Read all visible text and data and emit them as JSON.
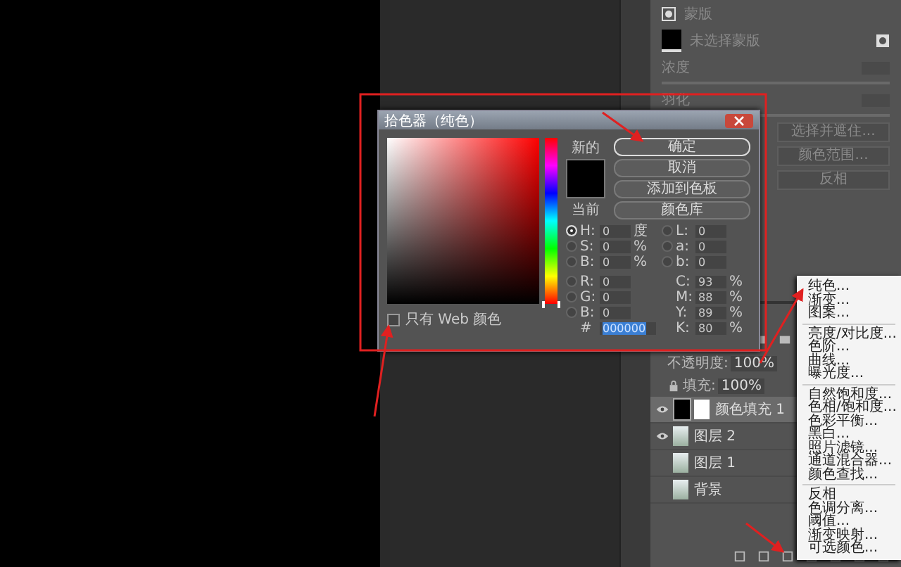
{
  "properties": {
    "mask_title": "蒙版",
    "mask_hint": "未选择蒙版",
    "sliders": [
      {
        "label": "浓度"
      },
      {
        "label": "羽化"
      }
    ],
    "buttons": [
      "选择并遮住...",
      "颜色范围...",
      "反相"
    ]
  },
  "dialog": {
    "title": "拾色器（纯色）",
    "new_label": "新的",
    "current_label": "当前",
    "buttons": [
      {
        "label": "确定",
        "default": true
      },
      {
        "label": "取消",
        "default": false
      },
      {
        "label": "添加到色板",
        "default": false
      },
      {
        "label": "颜色库",
        "default": false
      }
    ],
    "left_fields": [
      {
        "kind": "radio",
        "label": "H:",
        "value": "0",
        "unit": "度",
        "selected": true
      },
      {
        "kind": "radio",
        "label": "S:",
        "value": "0",
        "unit": "%",
        "selected": false
      },
      {
        "kind": "radio",
        "label": "B:",
        "value": "0",
        "unit": "%",
        "selected": false
      },
      {
        "kind": "radio",
        "label": "R:",
        "value": "0",
        "selected": false
      },
      {
        "kind": "radio",
        "label": "G:",
        "value": "0",
        "selected": false
      },
      {
        "kind": "radio",
        "label": "B:",
        "value": "0",
        "selected": false
      }
    ],
    "right_fields": [
      {
        "kind": "radio",
        "label": "L:",
        "value": "0",
        "selected": false
      },
      {
        "kind": "radio",
        "label": "a:",
        "value": "0",
        "selected": false
      },
      {
        "kind": "radio",
        "label": "b:",
        "value": "0",
        "selected": false
      },
      {
        "kind": "plain",
        "label": "C:",
        "value": "93",
        "unit": "%"
      },
      {
        "kind": "plain",
        "label": "M:",
        "value": "88",
        "unit": "%"
      },
      {
        "kind": "plain",
        "label": "Y:",
        "value": "89",
        "unit": "%"
      },
      {
        "kind": "plain",
        "label": "K:",
        "value": "80",
        "unit": "%"
      }
    ],
    "hue": {
      "level": 0
    },
    "hex": {
      "label": "#",
      "value": "000000"
    },
    "web_only": {
      "label": "只有 Web 颜色",
      "checked": false
    }
  },
  "layers": {
    "opacity_label": "不透明度:",
    "opacity": "100%",
    "fill_label": "填充:",
    "fill": "100%",
    "items": [
      {
        "name": "颜色填充 1",
        "kind": "fill",
        "visible": true,
        "selected": true
      },
      {
        "name": "图层 2",
        "kind": "image",
        "visible": true,
        "selected": false
      },
      {
        "name": "图层 1",
        "kind": "image",
        "visible": false,
        "selected": false
      },
      {
        "name": "背景",
        "kind": "image",
        "visible": false,
        "selected": false
      }
    ]
  },
  "menu": {
    "sections": [
      [
        "纯色...",
        "渐变...",
        "图案..."
      ],
      [
        "亮度/对比度...",
        "色阶...",
        "曲线...",
        "曝光度..."
      ],
      [
        "自然饱和度...",
        "色相/饱和度...",
        "色彩平衡...",
        "黑白...",
        "照片滤镜...",
        "通道混合器...",
        "颜色查找..."
      ],
      [
        "反相",
        "色调分离...",
        "阈值...",
        "渐变映射...",
        "可选颜色..."
      ]
    ]
  }
}
